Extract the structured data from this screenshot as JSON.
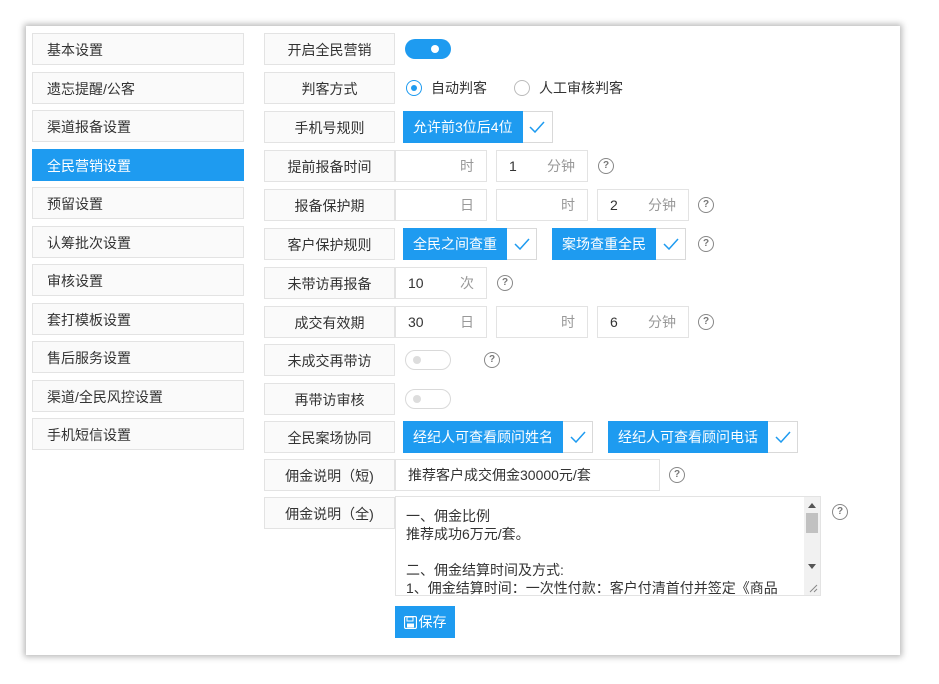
{
  "sidebar": {
    "items": [
      {
        "label": "基本设置",
        "active": false
      },
      {
        "label": "遗忘提醒/公客",
        "active": false
      },
      {
        "label": "渠道报备设置",
        "active": false
      },
      {
        "label": "全民营销设置",
        "active": true
      },
      {
        "label": "预留设置",
        "active": false
      },
      {
        "label": "认筹批次设置",
        "active": false
      },
      {
        "label": "审核设置",
        "active": false
      },
      {
        "label": "套打模板设置",
        "active": false
      },
      {
        "label": "售后服务设置",
        "active": false
      },
      {
        "label": "渠道/全民风控设置",
        "active": false
      },
      {
        "label": "手机短信设置",
        "active": false
      }
    ]
  },
  "form": {
    "enable_marketing": {
      "label": "开启全民营销",
      "on": true
    },
    "judge_method": {
      "label": "判客方式",
      "option_auto": "自动判客",
      "option_manual": "人工审核判客",
      "selected": "auto"
    },
    "phone_rule": {
      "label": "手机号规则",
      "tag": "允许前3位后4位"
    },
    "advance_report": {
      "label": "提前报备时间",
      "hour_value": "",
      "hour_unit": "时",
      "minute_value": "1",
      "minute_unit": "分钟"
    },
    "report_protect": {
      "label": "报备保护期",
      "day_value": "",
      "day_unit": "日",
      "hour_value": "",
      "hour_unit": "时",
      "minute_value": "2",
      "minute_unit": "分钟"
    },
    "customer_protect": {
      "label": "客户保护规则",
      "tag1": "全民之间查重",
      "tag2": "案场查重全民"
    },
    "no_visit_rereport": {
      "label": "未带访再报备",
      "value": "10",
      "unit": "次"
    },
    "deal_valid": {
      "label": "成交有效期",
      "day_value": "30",
      "day_unit": "日",
      "hour_value": "",
      "hour_unit": "时",
      "minute_value": "6",
      "minute_unit": "分钟"
    },
    "no_deal_revisit": {
      "label": "未成交再带访",
      "on": false
    },
    "revisit_review": {
      "label": "再带访审核",
      "on": false
    },
    "site_cooperate": {
      "label": "全民案场协同",
      "tag1": "经纪人可查看顾问姓名",
      "tag2": "经纪人可查看顾问电话"
    },
    "commission_short": {
      "label": "佣金说明（短)",
      "value": "推荐客户成交佣金30000元/套"
    },
    "commission_full": {
      "label": "佣金说明（全)",
      "lines": [
        "一、佣金比例",
        "推荐成功6万元/套。",
        "",
        "二、佣金结算时间及方式:",
        "1、佣金结算时间：一次性付款：客户付清首付并签定《商品"
      ]
    },
    "save_label": "保存"
  },
  "help_glyph": "?",
  "colors": {
    "accent": "#1e9bf0"
  }
}
